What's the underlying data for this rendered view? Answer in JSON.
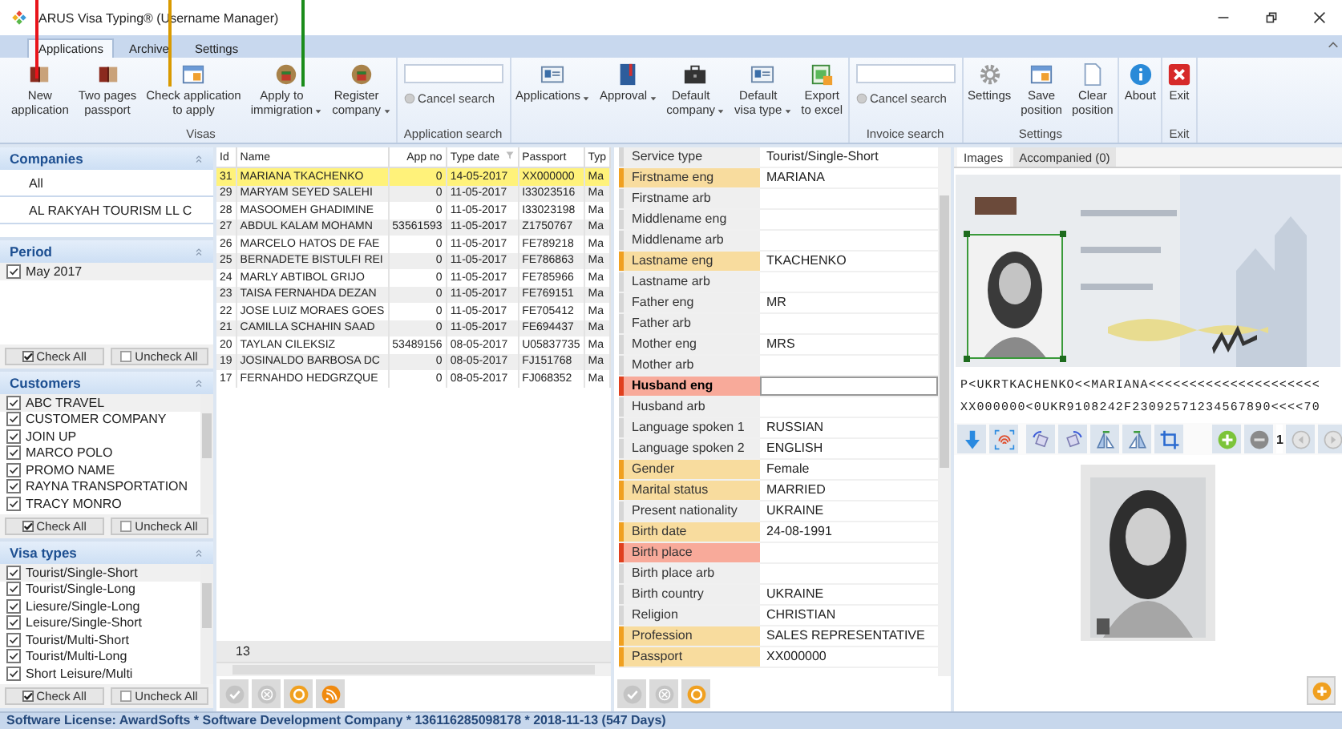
{
  "markers": [
    {
      "color": "#e8141b"
    },
    {
      "color": "#d99a00"
    },
    {
      "color": "#1a8c1a"
    }
  ],
  "window": {
    "title": "ARUS Visa Typing® (Username Manager)"
  },
  "ribbon": {
    "tabs": [
      {
        "label": "Applications",
        "selected": true
      },
      {
        "label": "Archive",
        "selected": false
      },
      {
        "label": "Settings",
        "selected": false
      }
    ],
    "groups": [
      {
        "label": "Visas",
        "items": [
          {
            "kind": "button",
            "label": "New\napplication",
            "dropdown": false
          },
          {
            "kind": "button",
            "label": "Two pages\npassport",
            "dropdown": false
          },
          {
            "kind": "button",
            "label": "Check application\nto apply",
            "dropdown": false
          },
          {
            "kind": "button",
            "label": "Apply to\nimmigration",
            "dropdown": true
          },
          {
            "kind": "button",
            "label": "Register\ncompany",
            "dropdown": true
          }
        ]
      },
      {
        "label": "Application search",
        "items": [
          {
            "kind": "search",
            "action": "Cancel search"
          }
        ]
      },
      {
        "items": [
          {
            "kind": "button",
            "label": "Applications",
            "dropdown": true
          },
          {
            "kind": "button",
            "label": "Approval",
            "dropdown": true
          },
          {
            "kind": "button",
            "label": "Default\ncompany",
            "dropdown": true
          },
          {
            "kind": "button",
            "label": "Default\nvisa type",
            "dropdown": true
          },
          {
            "kind": "button",
            "label": "Export\nto excel",
            "dropdown": false
          }
        ]
      },
      {
        "label": "Invoice search",
        "items": [
          {
            "kind": "search",
            "action": "Cancel search"
          }
        ]
      },
      {
        "label": "Settings",
        "items": [
          {
            "kind": "button",
            "label": "Settings",
            "dropdown": false
          },
          {
            "kind": "button",
            "label": "Save\nposition",
            "dropdown": false
          },
          {
            "kind": "button",
            "label": "Clear\nposition",
            "dropdown": false
          }
        ]
      },
      {
        "items": [
          {
            "kind": "button",
            "label": "About",
            "dropdown": false
          }
        ]
      },
      {
        "label": "Exit",
        "items": [
          {
            "kind": "button",
            "label": "Exit",
            "dropdown": false
          }
        ]
      }
    ]
  },
  "sections": [
    {
      "kind": "list",
      "title": "Companies",
      "items": [
        {
          "label": "All"
        },
        {
          "label": "AL RAKYAH TOURISM LL C"
        }
      ]
    },
    {
      "kind": "checklist",
      "title": "Period",
      "items": [
        {
          "label": "May 2017",
          "checked": true
        }
      ],
      "check_all": "Check All",
      "uncheck_all": "Uncheck All"
    },
    {
      "kind": "checklist",
      "title": "Customers",
      "items": [
        {
          "label": "ABC TRAVEL",
          "checked": true
        },
        {
          "label": "CUSTOMER COMPANY",
          "checked": true
        },
        {
          "label": "JOIN UP",
          "checked": true
        },
        {
          "label": "MARCO POLO",
          "checked": true
        },
        {
          "label": "PROMO NAME",
          "checked": true
        },
        {
          "label": "RAYNA TRANSPORTATION",
          "checked": true
        },
        {
          "label": "TRACY MONRO",
          "checked": true
        }
      ],
      "check_all": "Check All",
      "uncheck_all": "Uncheck All"
    },
    {
      "kind": "checklist",
      "title": "Visa types",
      "items": [
        {
          "label": "Tourist/Single-Short",
          "checked": true
        },
        {
          "label": "Tourist/Single-Long",
          "checked": true
        },
        {
          "label": "Liesure/Single-Long",
          "checked": true
        },
        {
          "label": "Leisure/Single-Short",
          "checked": true
        },
        {
          "label": "Tourist/Multi-Short",
          "checked": true
        },
        {
          "label": "Tourist/Multi-Long",
          "checked": true
        },
        {
          "label": "Short Leisure/Multi",
          "checked": true
        }
      ],
      "check_all": "Check All",
      "uncheck_all": "Uncheck All"
    }
  ],
  "grid": {
    "columns": [
      "Id",
      "Name",
      "App no",
      "Type date",
      "Passport",
      "Typ"
    ],
    "rows": [
      {
        "cells": [
          "31",
          "MARIANA TKACHENKO",
          "0",
          "14-05-2017",
          "XX000000",
          "Ma"
        ],
        "selected": true
      },
      {
        "cells": [
          "29",
          "MARYAM SEYED SALEHI",
          "0",
          "11-05-2017",
          "I33023516",
          "Ma"
        ],
        "selected": false
      },
      {
        "cells": [
          "28",
          "MASOOMEH GHADIMINE",
          "0",
          "11-05-2017",
          "I33023198",
          "Ma"
        ],
        "selected": false
      },
      {
        "cells": [
          "27",
          "ABDUL KALAM MOHAMN",
          "53561593",
          "11-05-2017",
          "Z1750767",
          "Ma"
        ],
        "selected": false
      },
      {
        "cells": [
          "26",
          "MARCELO HATOS DE FAE",
          "0",
          "11-05-2017",
          "FE789218",
          "Ma"
        ],
        "selected": false
      },
      {
        "cells": [
          "25",
          "BERNADETE BISTULFI REI",
          "0",
          "11-05-2017",
          "FE786863",
          "Ma"
        ],
        "selected": false
      },
      {
        "cells": [
          "24",
          "MARLY ABTIBOL GRIJO",
          "0",
          "11-05-2017",
          "FE785966",
          "Ma"
        ],
        "selected": false
      },
      {
        "cells": [
          "23",
          "TAISA FERNAHDA DEZAN",
          "0",
          "11-05-2017",
          "FE769151",
          "Ma"
        ],
        "selected": false
      },
      {
        "cells": [
          "22",
          "JOSE LUIZ MORAES GOES",
          "0",
          "11-05-2017",
          "FE705412",
          "Ma"
        ],
        "selected": false
      },
      {
        "cells": [
          "21",
          "CAMILLA SCHAHIN SAAD",
          "0",
          "11-05-2017",
          "FE694437",
          "Ma"
        ],
        "selected": false
      },
      {
        "cells": [
          "20",
          "TAYLAN CILEKSIZ",
          "53489156",
          "08-05-2017",
          "U05837735",
          "Ma"
        ],
        "selected": false
      },
      {
        "cells": [
          "19",
          "JOSINALDO BARBOSA DC",
          "0",
          "08-05-2017",
          "FJ151768",
          "Ma"
        ],
        "selected": false
      },
      {
        "cells": [
          "17",
          "FERNAHDO HEDGRZQUE",
          "0",
          "08-05-2017",
          "FJ068352",
          "Ma"
        ],
        "selected": false
      }
    ],
    "count": "13"
  },
  "form": {
    "fields": [
      {
        "label": "Service type",
        "value": "Tourist/Single-Short",
        "kind": "normal",
        "focused": false
      },
      {
        "label": "Firstname eng",
        "value": "MARIANA",
        "kind": "required",
        "focused": false
      },
      {
        "label": "Firstname arb",
        "kind": "normal",
        "focused": false
      },
      {
        "label": "Middlename eng",
        "kind": "normal",
        "focused": false
      },
      {
        "label": "Middlename arb",
        "kind": "normal",
        "focused": false
      },
      {
        "label": "Lastname eng",
        "value": "TKACHENKO",
        "kind": "required",
        "focused": false
      },
      {
        "label": "Lastname arb",
        "kind": "normal",
        "focused": false
      },
      {
        "label": "Father eng",
        "value": "MR",
        "kind": "normal",
        "focused": false
      },
      {
        "label": "Father arb",
        "kind": "normal",
        "focused": false
      },
      {
        "label": "Mother eng",
        "value": "MRS",
        "kind": "normal",
        "focused": false
      },
      {
        "label": "Mother arb",
        "kind": "normal",
        "focused": false
      },
      {
        "label": "Husband eng",
        "kind": "error",
        "focused": true
      },
      {
        "label": "Husband arb",
        "kind": "normal",
        "focused": false
      },
      {
        "label": "Language spoken 1",
        "value": "RUSSIAN",
        "kind": "normal",
        "focused": false
      },
      {
        "label": "Language spoken 2",
        "value": "ENGLISH",
        "kind": "normal",
        "focused": false
      },
      {
        "label": "Gender",
        "value": "Female",
        "kind": "required",
        "focused": false
      },
      {
        "label": "Marital status",
        "value": "MARRIED",
        "kind": "required",
        "focused": false
      },
      {
        "label": "Present nationality",
        "value": "UKRAINE",
        "kind": "normal",
        "focused": false
      },
      {
        "label": "Birth date",
        "value": "24-08-1991",
        "kind": "required",
        "focused": false
      },
      {
        "label": "Birth place",
        "kind": "error",
        "focused": false
      },
      {
        "label": "Birth place arb",
        "kind": "normal",
        "focused": false
      },
      {
        "label": "Birth country",
        "value": "UKRAINE",
        "kind": "normal",
        "focused": false
      },
      {
        "label": "Religion",
        "value": "CHRISTIAN",
        "kind": "normal",
        "focused": false
      },
      {
        "label": "Profession",
        "value": "SALES REPRESENTATIVE",
        "kind": "required",
        "focused": false
      },
      {
        "label": "Passport",
        "value": "XX000000",
        "kind": "required",
        "focused": false
      }
    ]
  },
  "viewer": {
    "tabs": [
      {
        "label": "Images",
        "selected": true
      },
      {
        "label": "Accompanied (0)",
        "selected": false
      }
    ],
    "mrz": [
      "P<UKRTKACHENKO<<MARIANA<<<<<<<<<<<<<<<<<<<<<",
      "XX000000<0UKR9108242F23092571234567890<<<<70"
    ],
    "page": "1"
  },
  "status_bar": "Software License: AwardSofts * Software Development Company * 136116285098178 * 2018-11-13 (547 Days)"
}
